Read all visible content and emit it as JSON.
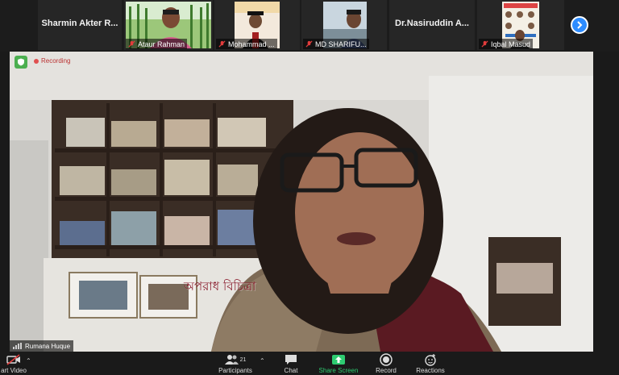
{
  "participants": [
    {
      "name": "Sharmin Akter R...",
      "has_video": false
    },
    {
      "name": "Ataur Rahman",
      "has_video": true
    },
    {
      "name": "Mohammad ...",
      "has_video": true
    },
    {
      "name": "MD SHARIFU...",
      "has_video": true
    },
    {
      "name": "Dr.Nasiruddin A...",
      "has_video": false
    },
    {
      "name": "Iqbal Masud",
      "has_video": true
    }
  ],
  "main_video": {
    "recording_label": "Recording",
    "speaker_name": "Rumana Huque",
    "caption": "অপরাধ বিচিত্রা"
  },
  "toolbar": {
    "start_video": "art Video",
    "participants": "Participants",
    "participants_count": "21",
    "chat": "Chat",
    "share_screen": "Share Screen",
    "record": "Record",
    "reactions": "Reactions"
  },
  "colors": {
    "accent_blue": "#2d8cff",
    "share_green": "#2ecc71",
    "mute_red": "#e23c3c"
  }
}
